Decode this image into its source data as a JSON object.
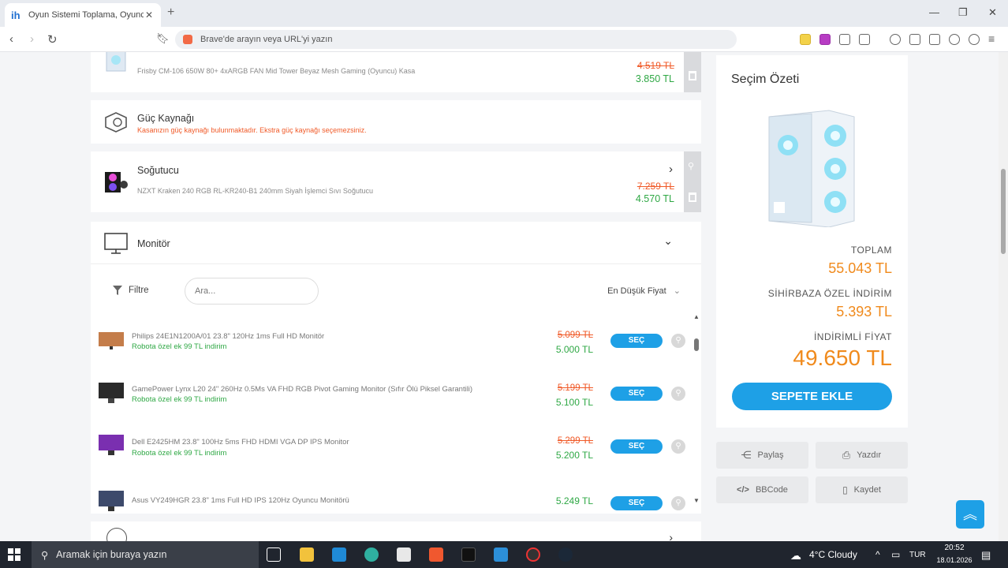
{
  "browser": {
    "tab_title": "Oyun Sistemi Toplama, Oyuncu P",
    "tab_favicon": "ih",
    "address_placeholder": "Brave'de arayın veya URL'yi yazın"
  },
  "components": {
    "case_desc": "Frisby CM-106 650W 80+ 4xARGB FAN Mid Tower Beyaz Mesh Gaming (Oyuncu) Kasa",
    "case_old": "4.519 TL",
    "case_new": "3.850 TL",
    "psu_name": "Güç Kaynağı",
    "psu_warn": "Kasanızın güç kaynağı bulunmaktadır. Ekstra güç kaynağı seçemezsiniz.",
    "cooler_name": "Soğutucu",
    "cooler_desc": "NZXT Kraken 240 RGB RL-KR240-B1 240mm Siyah İşlemci Sıvı Soğutucu",
    "cooler_old": "7.259 TL",
    "cooler_new": "4.570 TL",
    "monitor_name": "Monitör"
  },
  "filter": {
    "filter_label": "Filtre",
    "search_placeholder": "Ara...",
    "sort_label": "En Düşük Fiyat"
  },
  "products": [
    {
      "name": "Philips 24E1N1200A/01 23.8\" 120Hz 1ms Full HD Monitör",
      "bonus": "Robota özel ek 99 TL indirim",
      "old": "5.099 TL",
      "new": "5.000 TL",
      "button": "SEÇ"
    },
    {
      "name": "GamePower Lynx L20 24\" 260Hz 0.5Ms VA FHD RGB Pivot Gaming Monitor (Sıfır Ölü Piksel Garantili)",
      "bonus": "Robota özel ek 99 TL indirim",
      "old": "5.199 TL",
      "new": "5.100 TL",
      "button": "SEÇ"
    },
    {
      "name": "Dell E2425HM 23.8\" 100Hz 5ms FHD HDMI VGA DP IPS Monitor",
      "bonus": "Robota özel ek 99 TL indirim",
      "old": "5.299 TL",
      "new": "5.200 TL",
      "button": "SEÇ"
    },
    {
      "name": "Asus VY249HGR 23.8\" 1ms Full HD IPS 120Hz Oyuncu Monitörü",
      "bonus": "",
      "old": "",
      "new": "5.249 TL",
      "button": "SEÇ"
    }
  ],
  "summary": {
    "title": "Seçim Özeti",
    "total_label": "TOPLAM",
    "total_value": "55.043 TL",
    "discount_label": "SİHİRBAZA ÖZEL İNDİRİM",
    "discount_value": "5.393 TL",
    "final_label": "İNDİRİMLİ FİYAT",
    "final_value": "49.650 TL",
    "cart_button": "SEPETE EKLE",
    "share": "Paylaş",
    "print": "Yazdır",
    "bbcode": "BBCode",
    "save": "Kaydet"
  },
  "taskbar": {
    "search_placeholder": "Aramak için buraya yazın",
    "weather": "4°C Cloudy",
    "lang": "TUR",
    "time": "20:52",
    "date": "18.01.2026"
  },
  "colors": {
    "accent": "#1ea0e6",
    "old_price": "#f05a28",
    "new_price": "#2fa845",
    "summary_price": "#f08a1c"
  }
}
